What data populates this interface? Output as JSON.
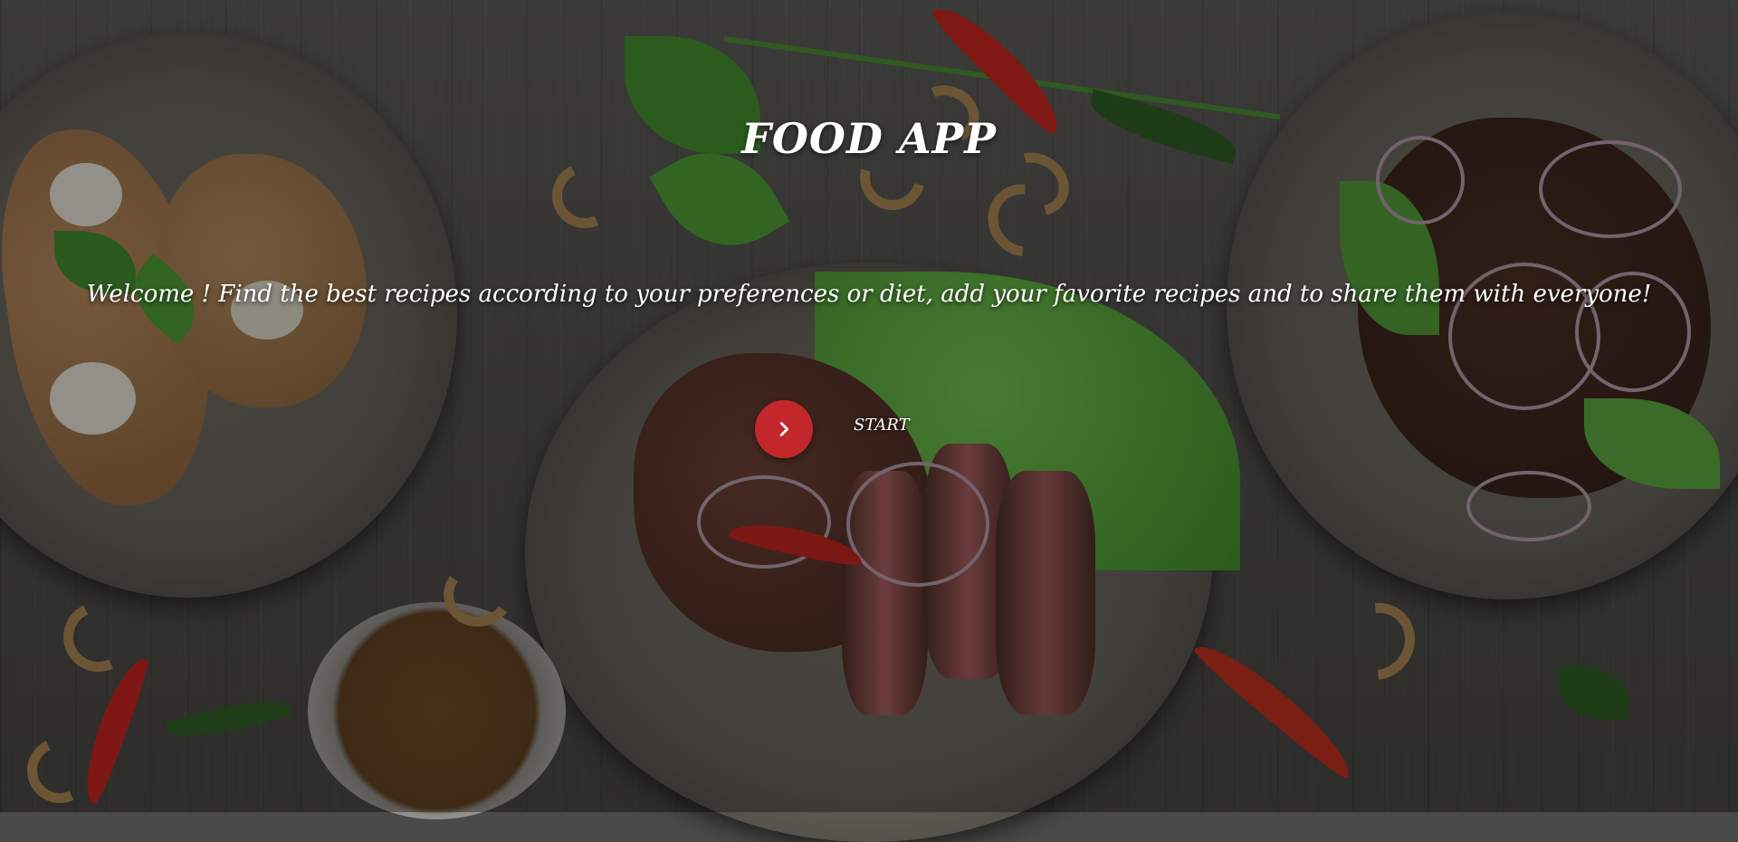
{
  "app": {
    "title": "FOOD APP",
    "welcome_text": "Welcome ! Find the best recipes according to your preferences or diet, add your favorite recipes and to share them with everyone!"
  },
  "start": {
    "label": "START",
    "icon": "chevron-right-icon",
    "button_color": "#c3272c"
  },
  "background": {
    "description_icon": "food-table-background-image"
  }
}
